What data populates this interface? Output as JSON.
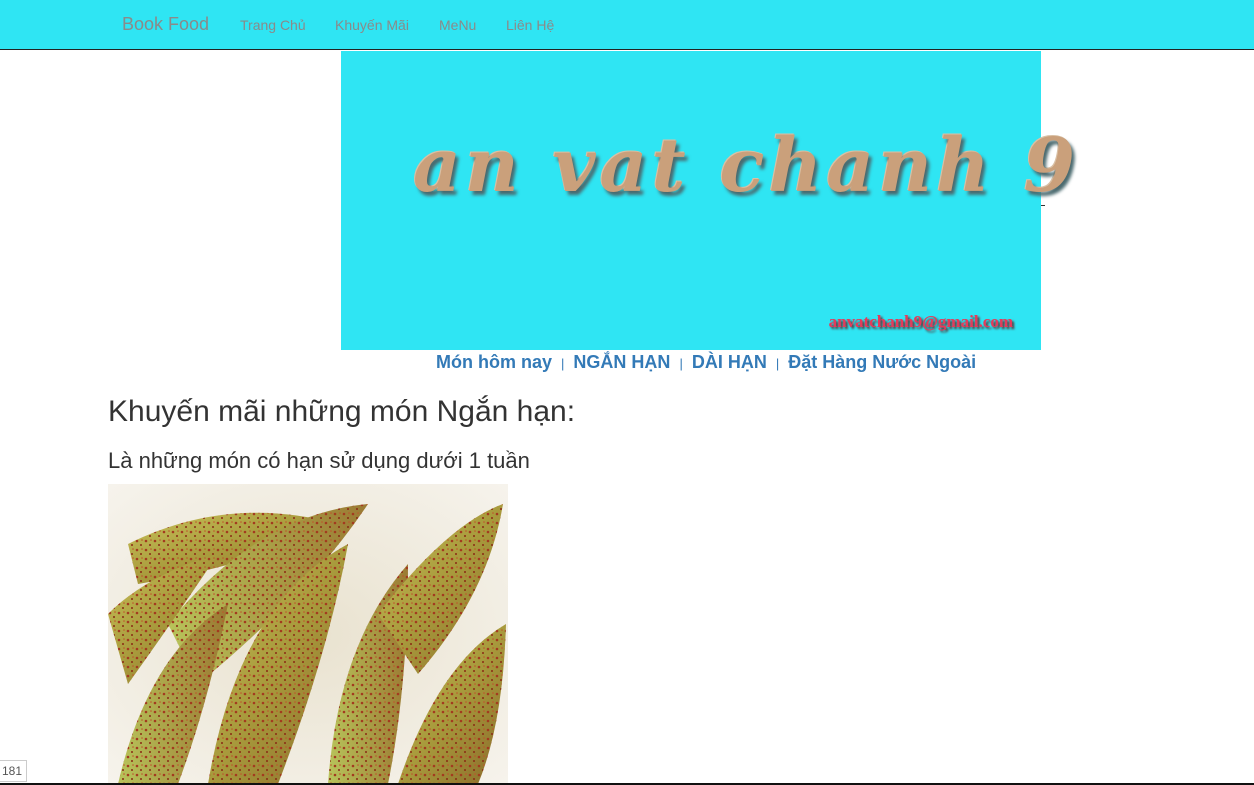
{
  "navbar": {
    "brand": "Book Food",
    "items": [
      "Trang Chủ",
      "Khuyến Mãi",
      "MeNu",
      "Liên Hệ"
    ]
  },
  "banner": {
    "title": "an vat chanh 9",
    "email": "anvatchanh9@gmail.com"
  },
  "subnav": {
    "items": [
      "Món hôm nay",
      "NGẮN HẠN",
      "DÀI HẠN",
      "Đặt Hàng Nước Ngoài"
    ],
    "separator": "|"
  },
  "content": {
    "heading": "Khuyến mãi những món Ngắn hạn:",
    "subheading": "Là những món có hạn sử dụng dưới 1 tuần",
    "image_icon": "food-photo"
  },
  "counter": "181",
  "colors": {
    "nav_bg": "#2fe5f3",
    "nav_text": "#8a8a8a",
    "link": "#337ab7",
    "banner_title": "#caa07b",
    "banner_email": "#e53a5a"
  }
}
